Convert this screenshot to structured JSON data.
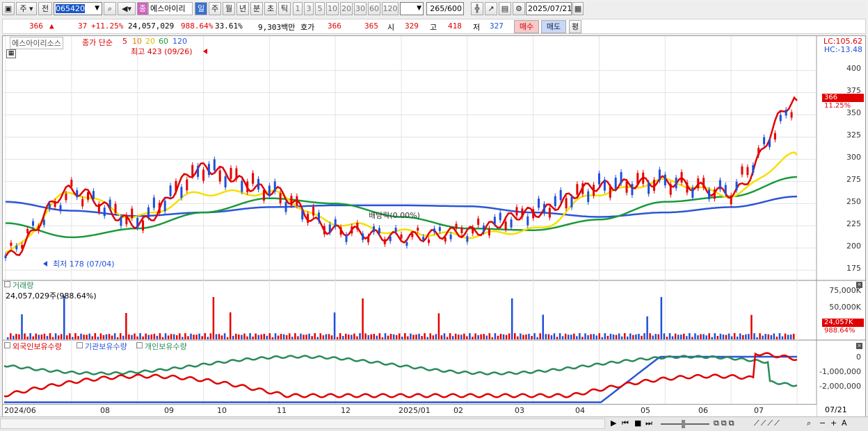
{
  "toolbar": {
    "period_label": "주",
    "prev_label": "전",
    "code": "065420",
    "stock_badge": "종",
    "stock_name": "에스아이리",
    "unit_day": "일",
    "unit_week": "주",
    "unit_month": "월",
    "unit_year": "년",
    "unit_minute": "분",
    "unit_second": "초",
    "unit_tick": "틱",
    "tick_options": [
      "1",
      "3",
      "5",
      "10",
      "20",
      "30",
      "60",
      "120"
    ],
    "count": "265",
    "count_total": "/600",
    "date": "2025/07/21"
  },
  "quote": {
    "price": "366",
    "change": "37",
    "change_pct": "+11.25%",
    "volume": "24,057,029",
    "volume_pct": "988.64%",
    "turnover": "33.61%",
    "amount": "9,303백만",
    "ask_label": "호가",
    "ask": "366",
    "bid": "365",
    "open_label": "시",
    "open": "329",
    "high_label": "고",
    "high": "418",
    "low_label": "저",
    "low": "327",
    "buy_label": "매수",
    "sell_label": "매도",
    "avg_label": "평"
  },
  "price_panel": {
    "legend_name": "에스아이리소스",
    "legend_ma": "종가 단순",
    "ma_periods": [
      "5",
      "10",
      "20",
      "60",
      "120"
    ],
    "lc": "LC:105.62",
    "hc": "HC:-13.48",
    "high_note": "최고 423 (09/26)",
    "low_note": "최저 178 (07/04)",
    "dividend_note": "배당락(0.00%)",
    "y_ticks": [
      "400",
      "375",
      "350",
      "325",
      "300",
      "275",
      "250",
      "225",
      "200",
      "175"
    ],
    "current_price": "366",
    "current_pct": "11.25%"
  },
  "volume_panel": {
    "title": "거래량",
    "value": "24,057,029주(988.64%)",
    "y_ticks": [
      "75,000K",
      "50,000K",
      "25,000K"
    ],
    "current": "24,057K",
    "current_pct": "988.64%"
  },
  "holding_panel": {
    "series": [
      "외국인보유수량",
      "기관보유수량",
      "개인보유수량"
    ],
    "y_ticks": [
      "0",
      "-1,000,000",
      "-2,000,000"
    ]
  },
  "x_axis": {
    "labels": [
      "2024/06",
      "08",
      "09",
      "10",
      "11",
      "12",
      "2025/01",
      "02",
      "03",
      "04",
      "05",
      "06",
      "07"
    ],
    "current": "07/21"
  },
  "colors": {
    "up": "#e60000",
    "down": "#1e4fd8",
    "ma5": "#e00000",
    "ma10": "#f08a00",
    "ma20": "#f5e000",
    "ma60": "#1a9a3a",
    "ma120": "#2a55d8",
    "foreign": "#e00000",
    "inst": "#2a55d8",
    "retail": "#2a8a5a"
  },
  "chart_data": {
    "type": "line",
    "x": [
      "2024/06",
      "08",
      "09",
      "10",
      "11",
      "12",
      "2025/01",
      "02",
      "03",
      "04",
      "05",
      "06",
      "07"
    ],
    "series": [
      {
        "name": "MA120",
        "values": [
          252,
          242,
          236,
          240,
          246,
          248,
          248,
          247,
          240,
          235,
          240,
          246,
          258
        ]
      },
      {
        "name": "MA60",
        "values": [
          228,
          212,
          222,
          240,
          256,
          250,
          235,
          222,
          220,
          232,
          252,
          258,
          280
        ]
      },
      {
        "name": "MA20",
        "values": [
          195,
          262,
          235,
          262,
          262,
          228,
          218,
          214,
          220,
          262,
          275,
          260,
          305
        ]
      },
      {
        "name": "5",
        "values": [
          190,
          265,
          228,
          290,
          265,
          220,
          212,
          218,
          240,
          270,
          275,
          262,
          366
        ]
      }
    ],
    "ylim": [
      165,
      420
    ]
  }
}
